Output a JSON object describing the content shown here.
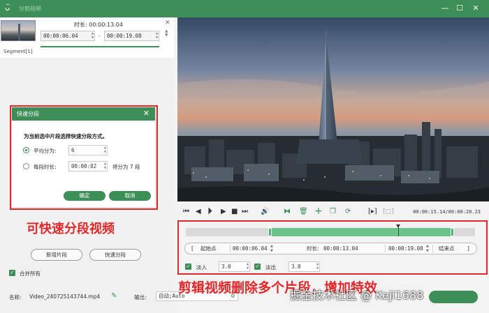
{
  "app": {
    "title": "分割视频",
    "icon": "rabbit-logo-icon"
  },
  "window_controls": {
    "minimize": "—",
    "maximize": "☐",
    "close": "✕"
  },
  "segment": {
    "label": "Segment[1]",
    "duration_label": "时长:",
    "duration": "00:00:13.04",
    "start": "00:00:06.04",
    "end": "00:00:19.08",
    "separator": "-"
  },
  "dialog": {
    "title": "快速分段",
    "instruction": "为当前选中片段选择快速分段方式。",
    "option_average_label": "平均分为:",
    "option_average_value": "6",
    "option_each_label": "每段时长:",
    "option_each_value": "00:00:02",
    "option_each_suffix": "将分为 7 段",
    "confirm": "确定",
    "cancel": "取消"
  },
  "annotations": {
    "left": "可快速分段视频",
    "bottom": "剪辑视频删除多个片段，增加特效",
    "watermark": "掘金技术社区 @ Keji1688"
  },
  "left_actions": {
    "new_segment": "新增片段",
    "quick_split": "快速分段",
    "merge_all": "合并所有"
  },
  "file": {
    "name_label": "名称:",
    "name_value": "Video_240725143744.mp4",
    "output_label": "输出:",
    "output_value": "自动;Auto"
  },
  "player": {
    "timecode": "00:00:15.14/00:00:20.23"
  },
  "trim": {
    "start_bracket": "[",
    "start_label": "起始点",
    "start_value": "00:00:06.04",
    "duration_label": "时长:",
    "duration_value": "00:00:13.04",
    "end_value": "00:00:19.08",
    "end_label": "结束点",
    "end_bracket": "]"
  },
  "effects": {
    "fade_in_label": "淡入",
    "fade_in_value": "3.0",
    "fade_out_label": "淡出",
    "fade_out_value": "3.0"
  },
  "timeline": {
    "selection_start": 0.285,
    "selection_end": 0.927,
    "playhead": 0.735
  },
  "colors": {
    "accent": "#3e8f57",
    "highlight": "#e0282b",
    "selection": "#6cc48a"
  }
}
